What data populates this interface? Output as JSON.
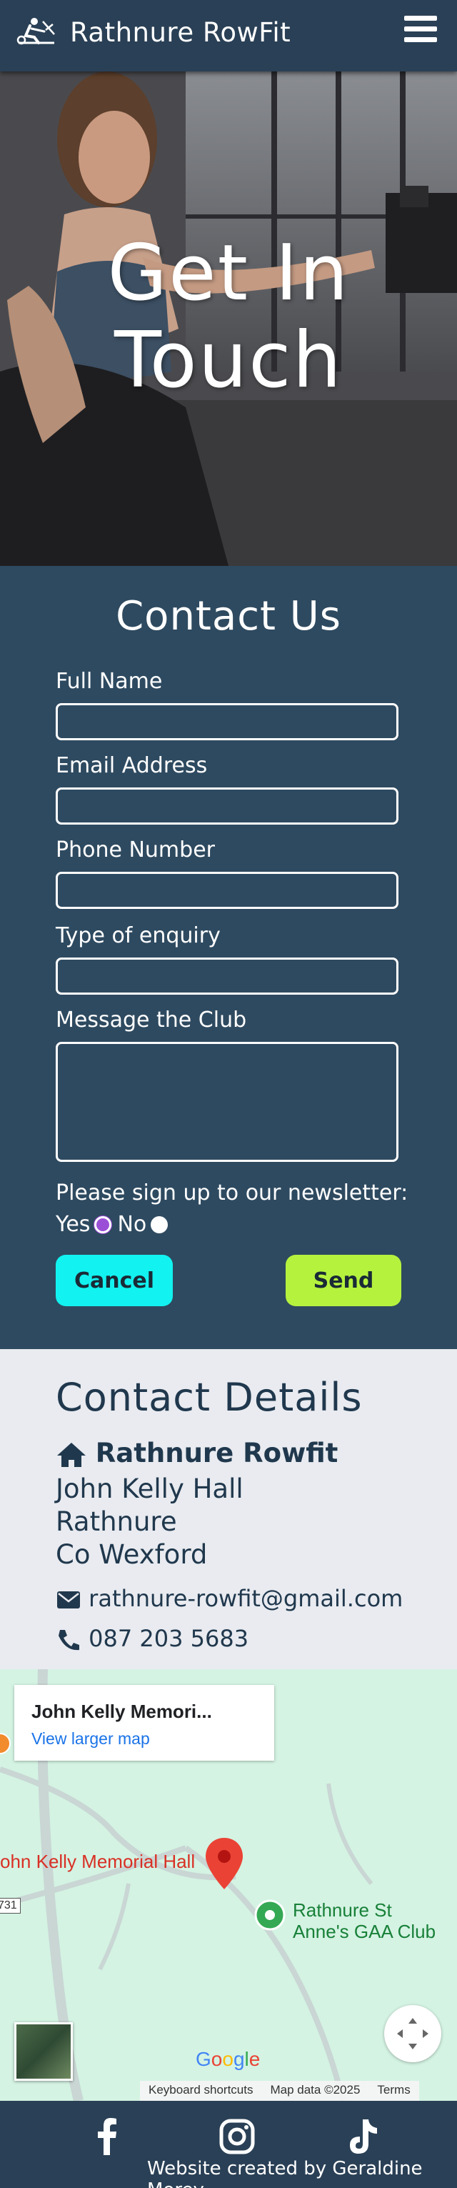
{
  "header": {
    "brand": "Rathnure RowFit",
    "logo_icon": "rower-icon",
    "menu_icon": "hamburger-menu-icon"
  },
  "hero": {
    "title_line1": "Get In",
    "title_line2": "Touch"
  },
  "contact_form": {
    "title": "Contact Us",
    "fields": [
      {
        "label": "Full Name",
        "value": ""
      },
      {
        "label": "Email Address",
        "value": ""
      },
      {
        "label": "Phone Number",
        "value": ""
      },
      {
        "label": "Type of enquiry",
        "value": ""
      },
      {
        "label": "Message the Club",
        "value": ""
      }
    ],
    "newsletter_prompt": "Please sign up to our newsletter:",
    "yes_label": "Yes",
    "no_label": "No",
    "newsletter_selected": "Yes",
    "cancel_label": "Cancel",
    "send_label": "Send",
    "colors": {
      "cancel": "#12f2f0",
      "send": "#b5f23e",
      "background": "#2e4a60"
    }
  },
  "contact_details": {
    "title": "Contact Details",
    "name": "Rathnure Rowfit",
    "address": [
      "John Kelly Hall",
      "Rathnure",
      "Co Wexford"
    ],
    "email": "rathnure-rowfit@gmail.com",
    "phone": "087 203 5683",
    "icons": [
      "home-icon",
      "envelope-icon",
      "phone-icon"
    ]
  },
  "map": {
    "card_title": "John Kelly Memori...",
    "card_link": "View larger map",
    "marker_label": "ohn Kelly Memorial Hall",
    "poi_label_line1": "Rathnure St",
    "poi_label_line2": "Anne's GAA Club",
    "road_sign": "731",
    "google_logo": "Google",
    "footer": [
      "Keyboard shortcuts",
      "Map data ©2025",
      "Terms"
    ]
  },
  "footer": {
    "social": [
      "facebook-icon",
      "instagram-icon",
      "tiktok-icon"
    ],
    "credit": "Website created by Geraldine Morey"
  }
}
